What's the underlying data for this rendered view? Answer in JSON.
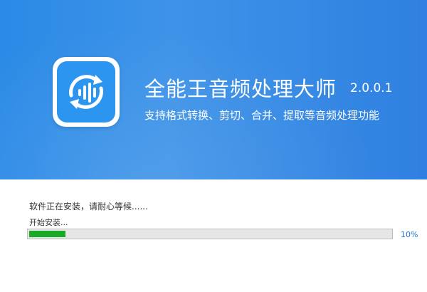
{
  "header": {
    "title": "全能王音频处理大师",
    "version": "2.0.0.1",
    "subtitle": "支持格式转换、剪切、合并、提取等音频处理功能",
    "icon": "audio-waveform-refresh-icon",
    "gradient_colors": [
      "#2a8ae6",
      "#2f80e0"
    ]
  },
  "install": {
    "status": "软件正在安装，请耐心等候......",
    "step": "开始安装...",
    "progress": 0.1,
    "progress_label": "10%",
    "progress_color": "#1aaa2a",
    "percent_color": "#1f74cc"
  }
}
